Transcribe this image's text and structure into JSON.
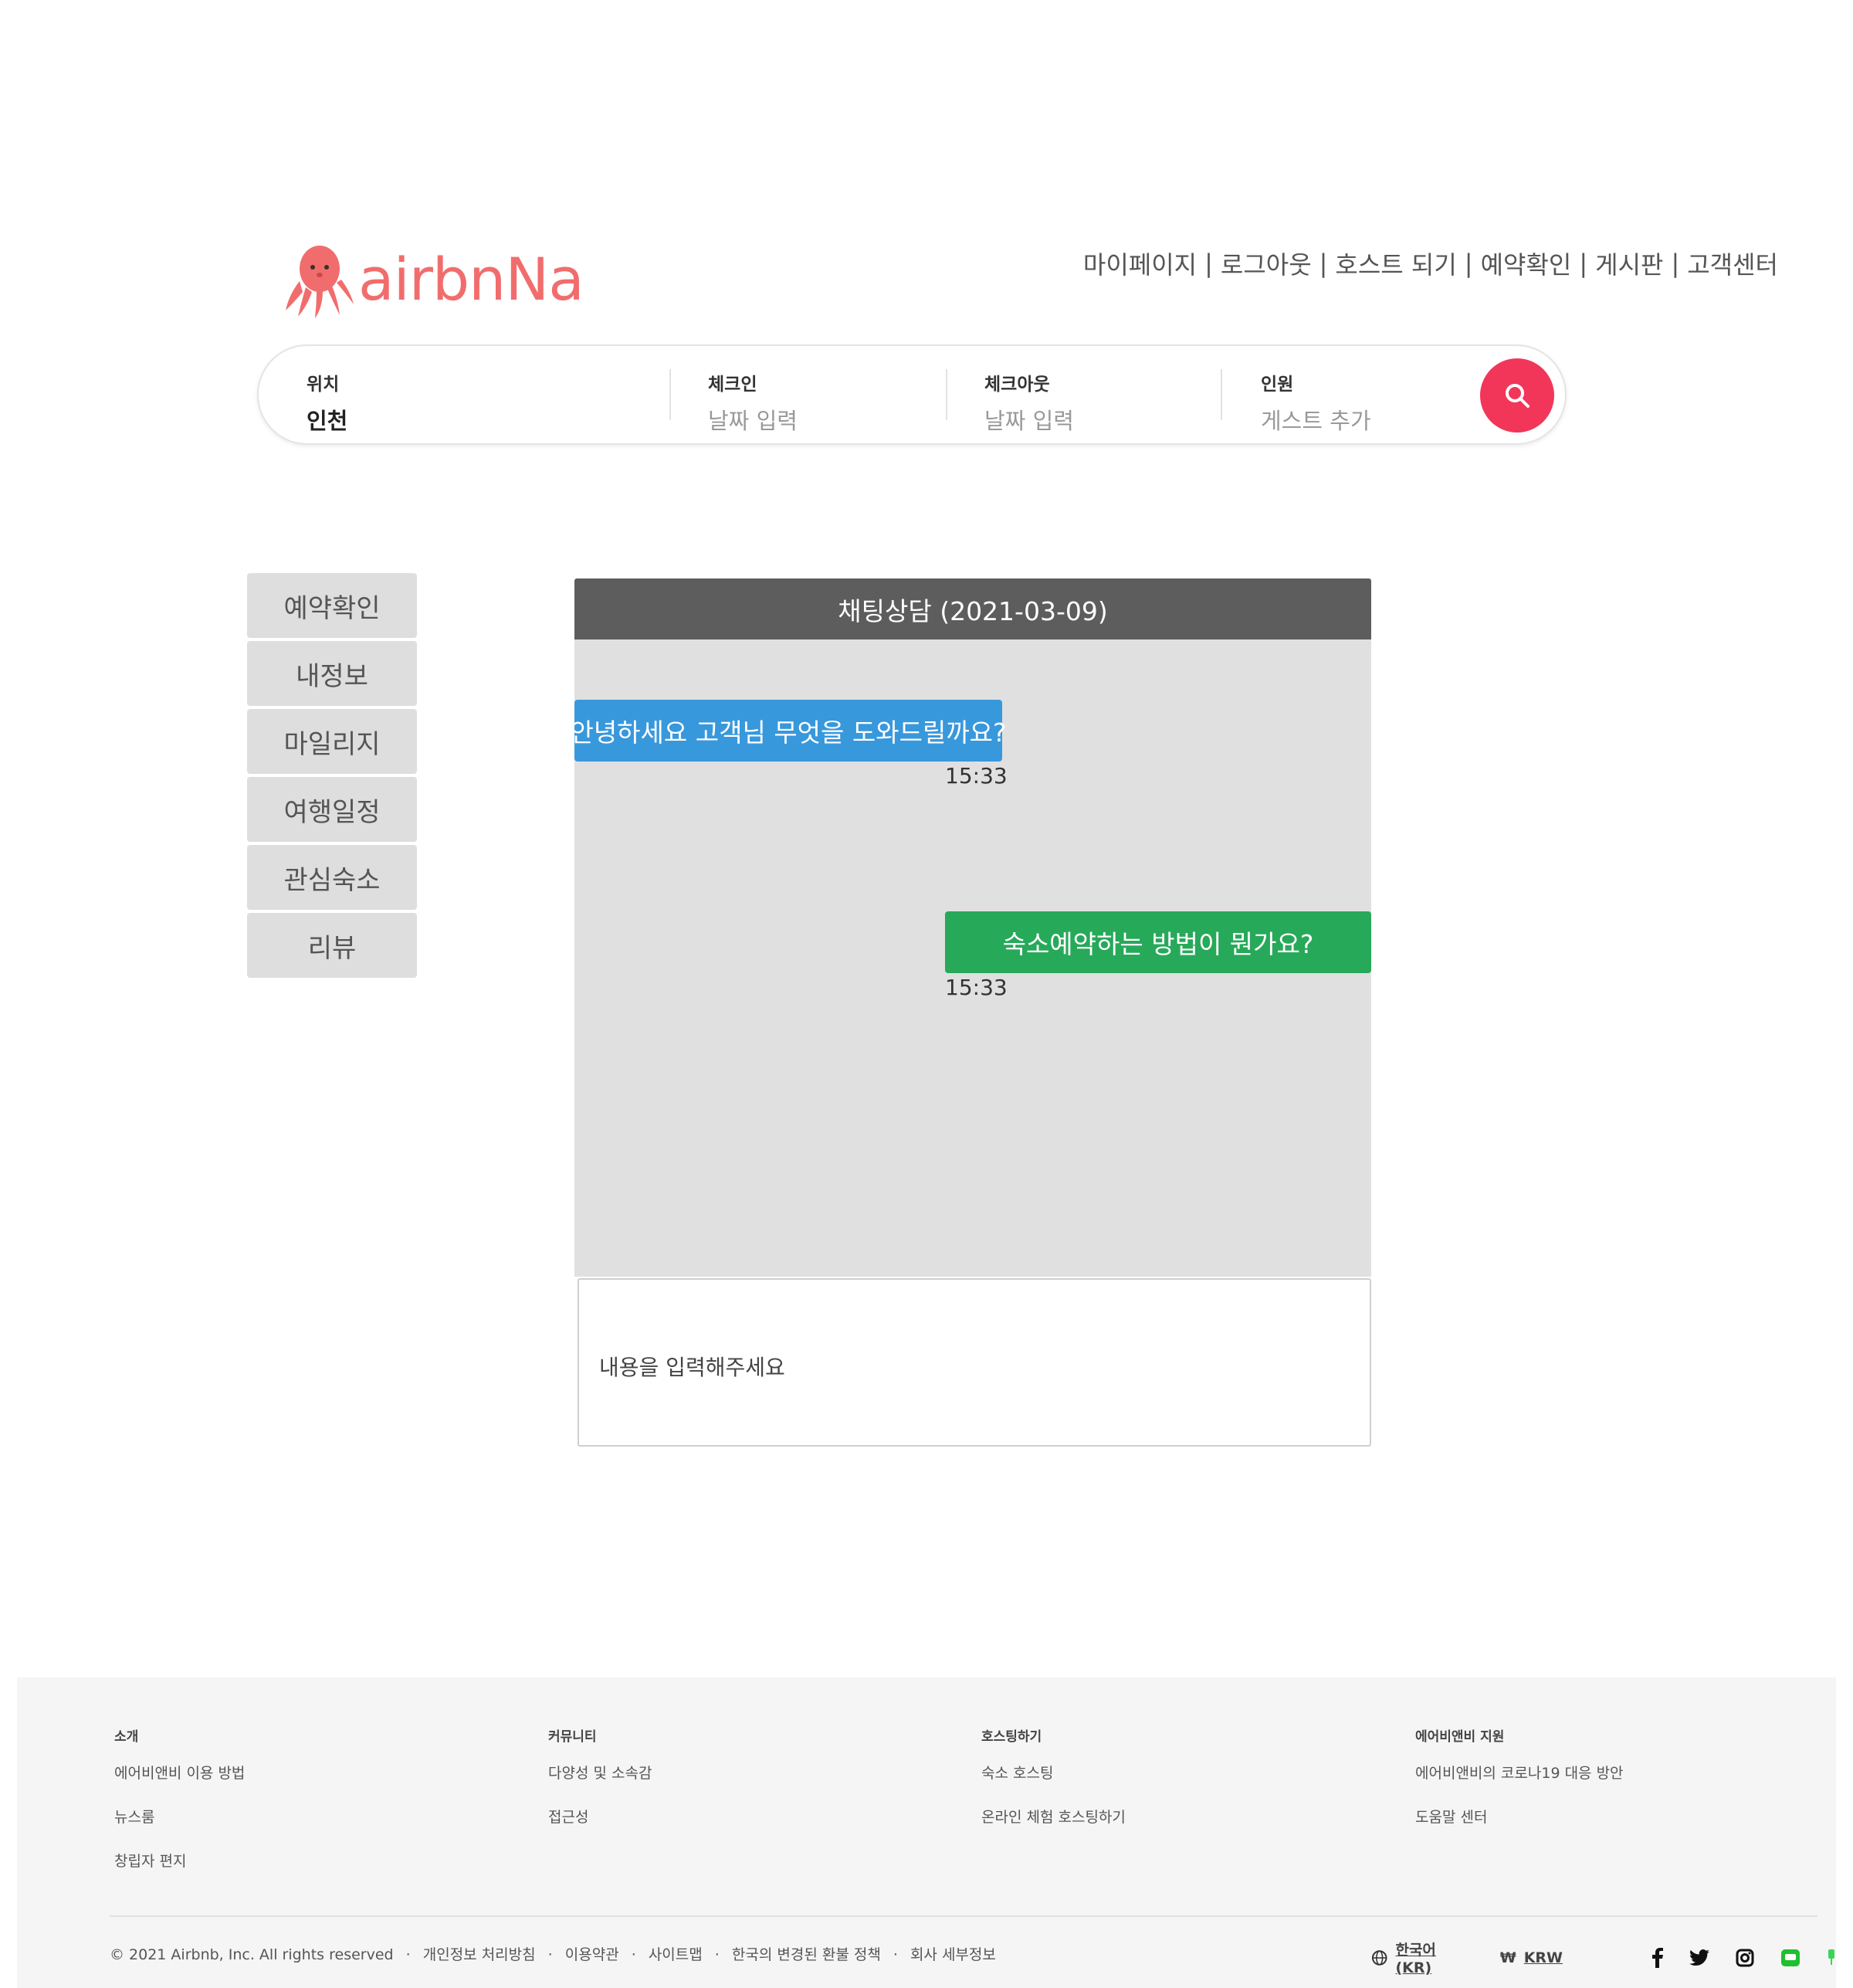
{
  "brand": {
    "name": "airbnNa",
    "color": "#f16d6d"
  },
  "topnav": {
    "items": [
      "마이페이지",
      "로그아웃",
      "호스트 되기",
      "예약확인",
      "게시판",
      "고객센터"
    ],
    "separator": "|"
  },
  "search": {
    "location": {
      "label": "위치",
      "value": "인천"
    },
    "checkin": {
      "label": "체크인",
      "placeholder": "날짜 입력"
    },
    "checkout": {
      "label": "체크아웃",
      "placeholder": "날짜 입력"
    },
    "guests": {
      "label": "인원",
      "placeholder": "게스트 추가"
    },
    "button_color": "#f2365a",
    "button_icon": "search-icon"
  },
  "sidebar": {
    "items": [
      {
        "label": "예약확인"
      },
      {
        "label": "내정보"
      },
      {
        "label": "마일리지"
      },
      {
        "label": "여행일정"
      },
      {
        "label": "관심숙소"
      },
      {
        "label": "리뷰"
      }
    ]
  },
  "chat": {
    "title": "채팅상담 (2021-03-09)",
    "messages": [
      {
        "from": "agent",
        "text": "안녕하세요 고객님 무엇을 도와드릴까요?",
        "time": "15:33",
        "color": "#3898dc"
      },
      {
        "from": "user",
        "text": "숙소예약하는 방법이 뭔가요?",
        "time": "15:33",
        "color": "#27a95a"
      }
    ],
    "input_placeholder": "내용을 입력해주세요"
  },
  "footer": {
    "columns": [
      {
        "title": "소개",
        "links": [
          "에어비앤비 이용 방법",
          "뉴스룸",
          "창립자 편지"
        ]
      },
      {
        "title": "커뮤니티",
        "links": [
          "다양성 및 소속감",
          "접근성"
        ]
      },
      {
        "title": "호스팅하기",
        "links": [
          "숙소 호스팅",
          "온라인 체험 호스팅하기"
        ]
      },
      {
        "title": "에어비앤비 지원",
        "links": [
          "에어비앤비의 코로나19 대응 방안",
          "도움말 센터"
        ]
      }
    ],
    "copyright": "© 2021 Airbnb, Inc. All rights reserved",
    "bottom_links": [
      "개인정보 처리방침",
      "이용약관",
      "사이트맵",
      "한국의 변경된 환불 정책",
      "회사 세부정보"
    ],
    "language": "한국어 (KR)",
    "currency_symbol": "₩",
    "currency": "KRW",
    "social_icons": [
      "facebook-icon",
      "twitter-icon",
      "instagram-icon",
      "line-icon",
      "naver-blog-icon"
    ]
  }
}
